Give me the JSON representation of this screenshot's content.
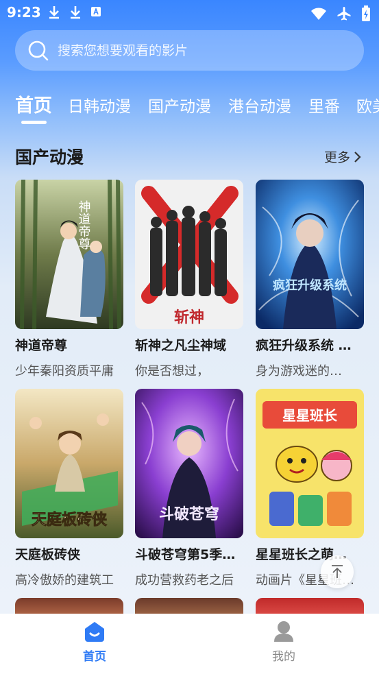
{
  "status_bar": {
    "time": "9:23"
  },
  "search": {
    "placeholder": "搜索您想要观看的影片"
  },
  "tabs": [
    {
      "label": "首页"
    },
    {
      "label": "日韩动漫"
    },
    {
      "label": "国产动漫"
    },
    {
      "label": "港台动漫"
    },
    {
      "label": "里番"
    },
    {
      "label": "欧美"
    }
  ],
  "section": {
    "title": "国产动漫",
    "more_label": "更多"
  },
  "cards": [
    {
      "title": "神道帝尊",
      "desc": "少年秦阳资质平庸"
    },
    {
      "title": "斩神之凡尘神域",
      "desc": "你是否想过，"
    },
    {
      "title": "疯狂升级系统 第二季",
      "desc": "身为游戏迷的…"
    },
    {
      "title": "天庭板砖侠",
      "desc": "高冷傲娇的建筑工"
    },
    {
      "title": "斗破苍穹第5季…",
      "desc": "成功营救药老之后"
    },
    {
      "title": "星星班长之萌…",
      "desc": "动画片《星星班长》"
    }
  ],
  "posters": [
    {
      "text": "神道帝尊"
    },
    {
      "text": "斩神"
    },
    {
      "text": "疯狂升级系统"
    },
    {
      "text": "天庭板砖侠"
    },
    {
      "text": "斗破苍穹"
    },
    {
      "text": "星星班长"
    }
  ],
  "bottom_nav": [
    {
      "label": "首页",
      "icon": "home-icon"
    },
    {
      "label": "我的",
      "icon": "profile-icon"
    }
  ],
  "colors": {
    "accent": "#2f7bf5",
    "header": "#3a86ff"
  }
}
